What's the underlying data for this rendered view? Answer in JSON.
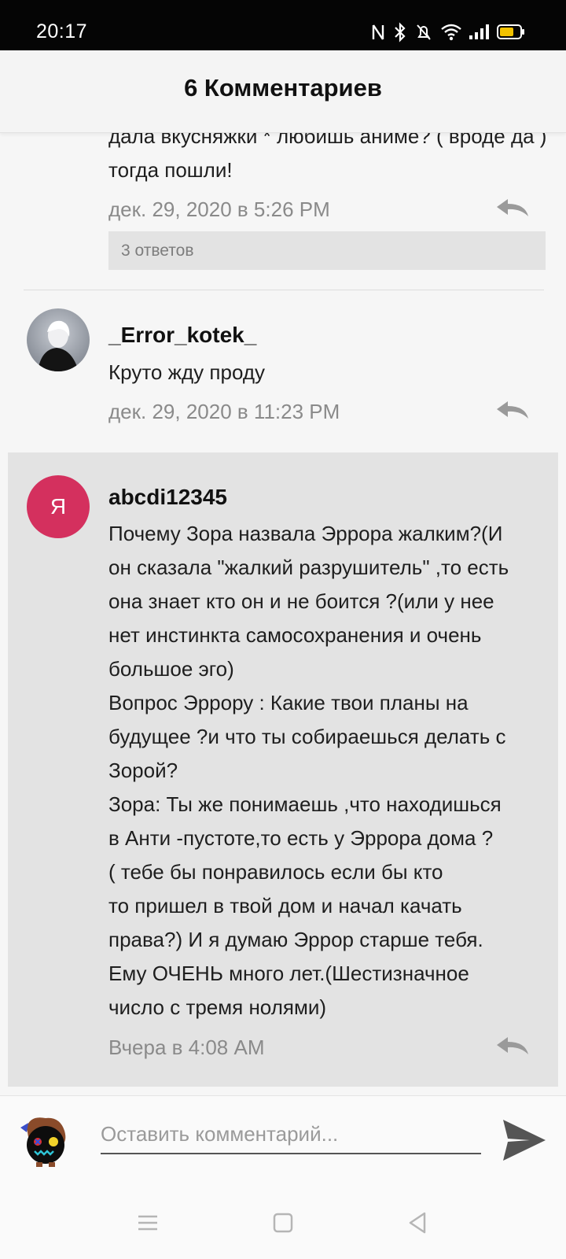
{
  "status_bar": {
    "time": "20:17",
    "icons": [
      "nfc-icon",
      "bluetooth-icon",
      "mute-icon",
      "wifi-icon",
      "signal-icon",
      "battery-icon"
    ],
    "battery_color": "#f2c200"
  },
  "header": {
    "title": "6 Комментариев"
  },
  "comments": [
    {
      "text": "дала вкусняжки * любишь аниме? ( вроде да ) тогда пошли!",
      "date": "дек. 29, 2020 в 5:26 PM",
      "replies_label": "3 ответов"
    },
    {
      "author": "_Error_kotek_",
      "text": "Круто жду проду",
      "date": "дек. 29, 2020 в 11:23 PM"
    },
    {
      "author": "abcdi12345",
      "avatar_letter": "Я",
      "avatar_color": "#d4305e",
      "text_lines": [
        "Почему Зора назвала  Эррора жалким?(И",
        "он сказала \"жалкий разрушитель\" ,то есть",
        "она знает кто он и не боится ?(или у нее",
        "нет инстинкта самосохранения и очень",
        "большое эго)",
        "Вопрос Эррору : Какие твои планы на",
        "будущее ?и что ты собираешься делать с",
        "Зорой?",
        "Зора: Ты же понимаешь ,что находишься",
        "в Анти -пустоте,то есть у Эррора дома ?",
        "( тебе бы понравилось если бы кто",
        "то пришел в твой дом и начал качать",
        "права?) И я думаю Эррор старше тебя.",
        "Ему  ОЧЕНЬ много лет.(Шестизначное",
        "число с тремя нолями)"
      ],
      "date": "Вчера в 4:08 AM",
      "highlighted": true
    }
  ],
  "composer": {
    "placeholder": "Оставить комментарий..."
  },
  "navbar": {
    "buttons": [
      "menu-icon",
      "home-icon",
      "back-icon"
    ]
  },
  "colors": {
    "accent_avatar": "#d4305e",
    "highlight_bg": "#e3e3e3",
    "date_text": "#8a8a8a"
  }
}
